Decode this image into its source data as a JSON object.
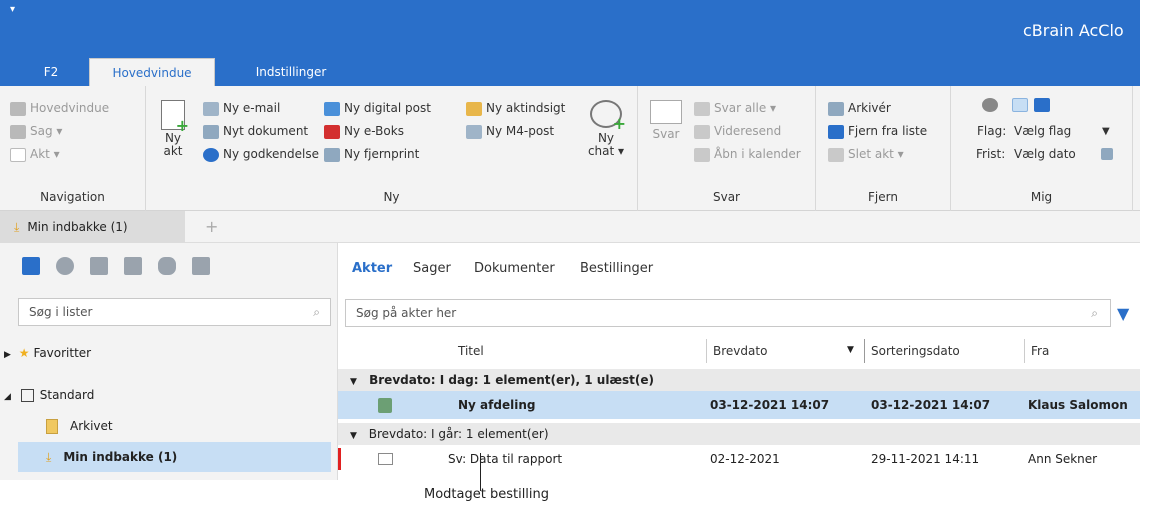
{
  "app": {
    "title": "cBrain AcClo",
    "quick_access": "▾"
  },
  "ribbon_tabs": [
    {
      "label": "F2"
    },
    {
      "label": "Hovedvindue"
    },
    {
      "label": "Indstillinger"
    }
  ],
  "ribbon": {
    "navigation": {
      "label": "Navigation",
      "items": [
        "Hovedvindue",
        "Sag ▾",
        "Akt ▾"
      ]
    },
    "ny": {
      "label": "Ny",
      "ny_akt": "Ny\nakt",
      "col1": [
        "Ny e-mail",
        "Nyt dokument",
        "Ny godkendelse"
      ],
      "col2": [
        "Ny digital post",
        "Ny e-Boks",
        "Ny fjernprint"
      ],
      "col3": [
        "Ny aktindsigt",
        "Ny M4-post"
      ],
      "ny_chat": "Ny\nchat ▾"
    },
    "svar": {
      "label": "Svar",
      "svar_big": "Svar",
      "items": [
        "Svar alle ▾",
        "Videresend",
        "Åbn i kalender"
      ]
    },
    "fjern": {
      "label": "Fjern",
      "items": [
        "Arkivér",
        "Fjern fra liste",
        "Slet akt ▾"
      ]
    },
    "mig": {
      "label": "Mig",
      "flag_label": "Flag:",
      "flag_value": "Vælg flag",
      "frist_label": "Frist:",
      "frist_value": "Vælg dato"
    }
  },
  "doc_tab": {
    "label": "Min indbakke (1)",
    "add": "+"
  },
  "left_panel": {
    "search_placeholder": "Søg i lister",
    "tree": {
      "favorites": "Favoritter",
      "standard": "Standard",
      "arkivet": "Arkivet",
      "min_indbakke": "Min indbakke (1)"
    }
  },
  "main_panel": {
    "tabs": [
      "Akter",
      "Sager",
      "Dokumenter",
      "Bestillinger"
    ],
    "search_placeholder": "Søg på akter her",
    "columns": [
      "Titel",
      "Brevdato",
      "Sorteringsdato",
      "Fra"
    ],
    "groups": [
      {
        "header": "Brevdato: I dag: 1 element(er), 1 ulæst(e)",
        "rows": [
          {
            "title": "Ny afdeling",
            "brevdato": "03-12-2021 14:07",
            "sorteringsdato": "03-12-2021 14:07",
            "fra": "Klaus Salomon"
          }
        ]
      },
      {
        "header": "Brevdato: I går: 1 element(er)",
        "rows": [
          {
            "title": "Sv: Data til rapport",
            "brevdato": "02-12-2021",
            "sorteringsdato": "29-11-2021 14:11",
            "fra": "Ann Sekner"
          }
        ]
      }
    ]
  },
  "callout": "Modtaget bestilling",
  "colors": {
    "accent": "#2a6fc9",
    "selection": "#c7def4",
    "marker": "#e02020"
  }
}
